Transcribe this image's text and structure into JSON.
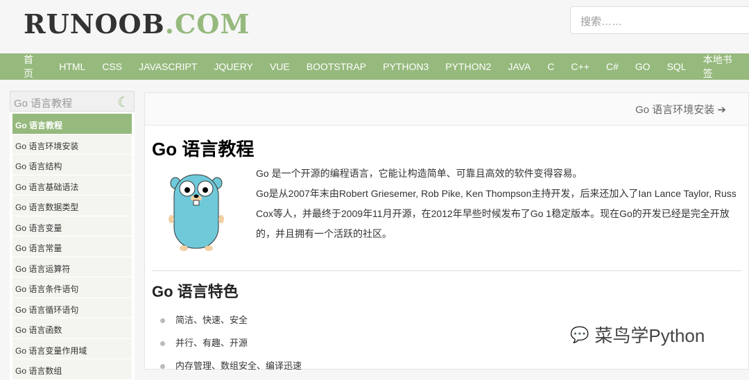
{
  "header": {
    "logo_main": "RUNOOB",
    "logo_accent": ".COM",
    "search_placeholder": "搜索……"
  },
  "nav": [
    "首页",
    "HTML",
    "CSS",
    "JAVASCRIPT",
    "JQUERY",
    "VUE",
    "BOOTSTRAP",
    "PYTHON3",
    "PYTHON2",
    "JAVA",
    "C",
    "C++",
    "C#",
    "GO",
    "SQL",
    "本地书签"
  ],
  "sidebar": {
    "title": "Go 语言教程",
    "items": [
      "Go 语言教程",
      "Go 语言环境安装",
      "Go 语言结构",
      "Go 语言基础语法",
      "Go 语言数据类型",
      "Go 语言变量",
      "Go 语言常量",
      "Go 语言运算符",
      "Go 语言条件语句",
      "Go 语言循环语句",
      "Go 语言函数",
      "Go 语言变量作用域",
      "Go 语言数组"
    ]
  },
  "content": {
    "next_link": "Go 语言环境安装 ➔",
    "title": "Go 语言教程",
    "para1": "Go 是一个开源的编程语言，它能让构造简单、可靠且高效的软件变得容易。",
    "para2": "Go是从2007年末由Robert Griesemer, Rob Pike, Ken Thompson主持开发，后来还加入了Ian Lance Taylor, Russ Cox等人，并最终于2009年11月开源，在2012年早些时候发布了Go 1稳定版本。现在Go的开发已经是完全开放的，并且拥有一个活跃的社区。",
    "features_title": "Go 语言特色",
    "features": [
      "简洁、快速、安全",
      "并行、有趣、开源",
      "内存管理、数组安全、编译迅速"
    ]
  },
  "watermark": "菜鸟学Python"
}
